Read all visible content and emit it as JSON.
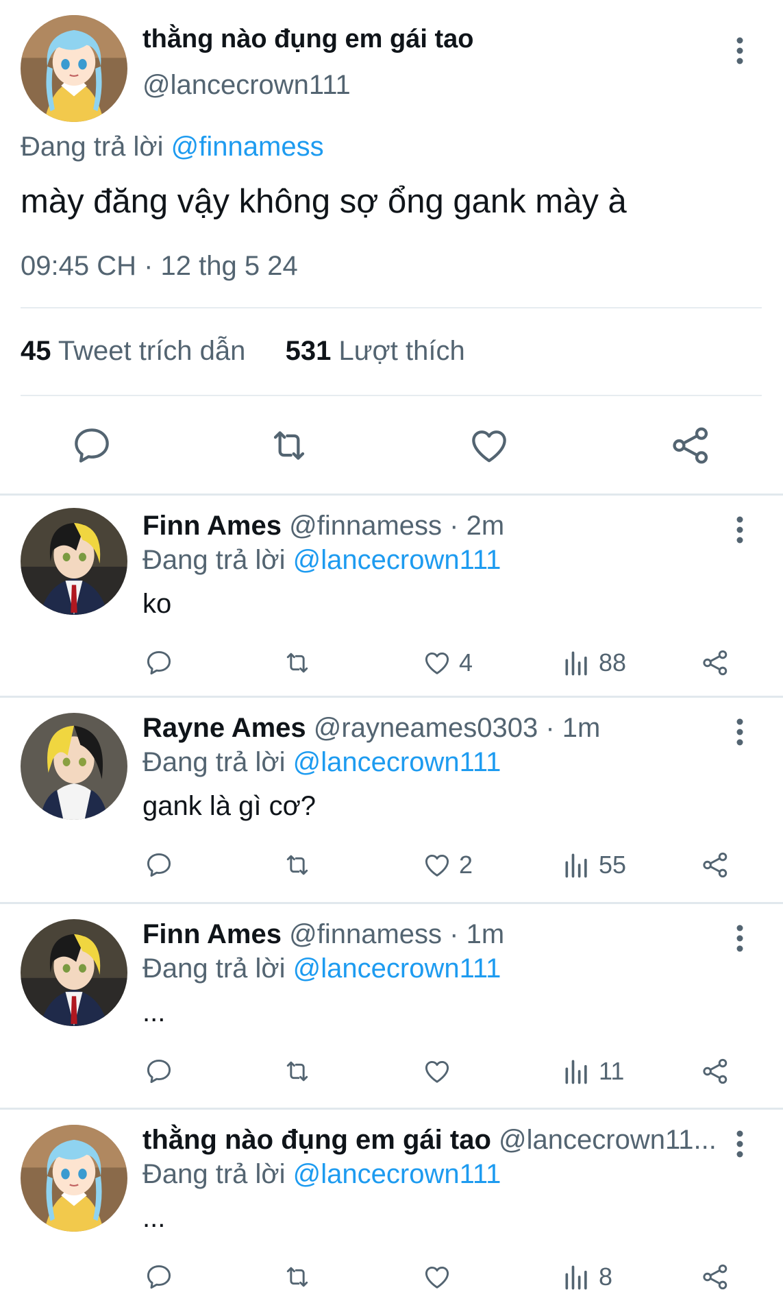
{
  "main_tweet": {
    "display_name": "thằng nào đụng em gái tao",
    "handle": "@lancecrown111",
    "replying_label": "Đang trả lời",
    "replying_to": "@finnamess",
    "text": "mày đăng vậy không sợ ổng gank mày à",
    "timestamp": "09:45 CH · 12 thg 5 24",
    "quote_count": "45",
    "quote_label": "Tweet trích dẫn",
    "like_count": "531",
    "like_label": "Lượt thích"
  },
  "replies": [
    {
      "name": "Finn Ames",
      "meta": "@finnamess · 2m",
      "replying_label": "Đang trả lời",
      "replying_to": "@lancecrown111",
      "text": "ko",
      "likes": "4",
      "views": "88"
    },
    {
      "name": "Rayne Ames",
      "meta": "@rayneames0303 · 1m",
      "replying_label": "Đang trả lời",
      "replying_to": "@lancecrown111",
      "text": "gank là gì cơ?",
      "likes": "2",
      "views": "55"
    },
    {
      "name": "Finn Ames",
      "meta": "@finnamess · 1m",
      "replying_label": "Đang trả lời",
      "replying_to": "@lancecrown111",
      "text": "...",
      "likes": "",
      "views": "11"
    },
    {
      "name": "thằng nào đụng em gái tao",
      "meta": "@lancecrown11...",
      "replying_label": "Đang trả lời",
      "replying_to": "@lancecrown111",
      "text": "...",
      "likes": "",
      "views": "8"
    }
  ],
  "colors": {
    "accent": "#1d9bf0",
    "secondary_text": "#536471",
    "primary_text": "#0f1419",
    "divider": "#e6ecf0"
  },
  "icons": [
    "reply-icon",
    "retweet-icon",
    "like-icon",
    "share-icon",
    "views-icon",
    "more-icon"
  ]
}
